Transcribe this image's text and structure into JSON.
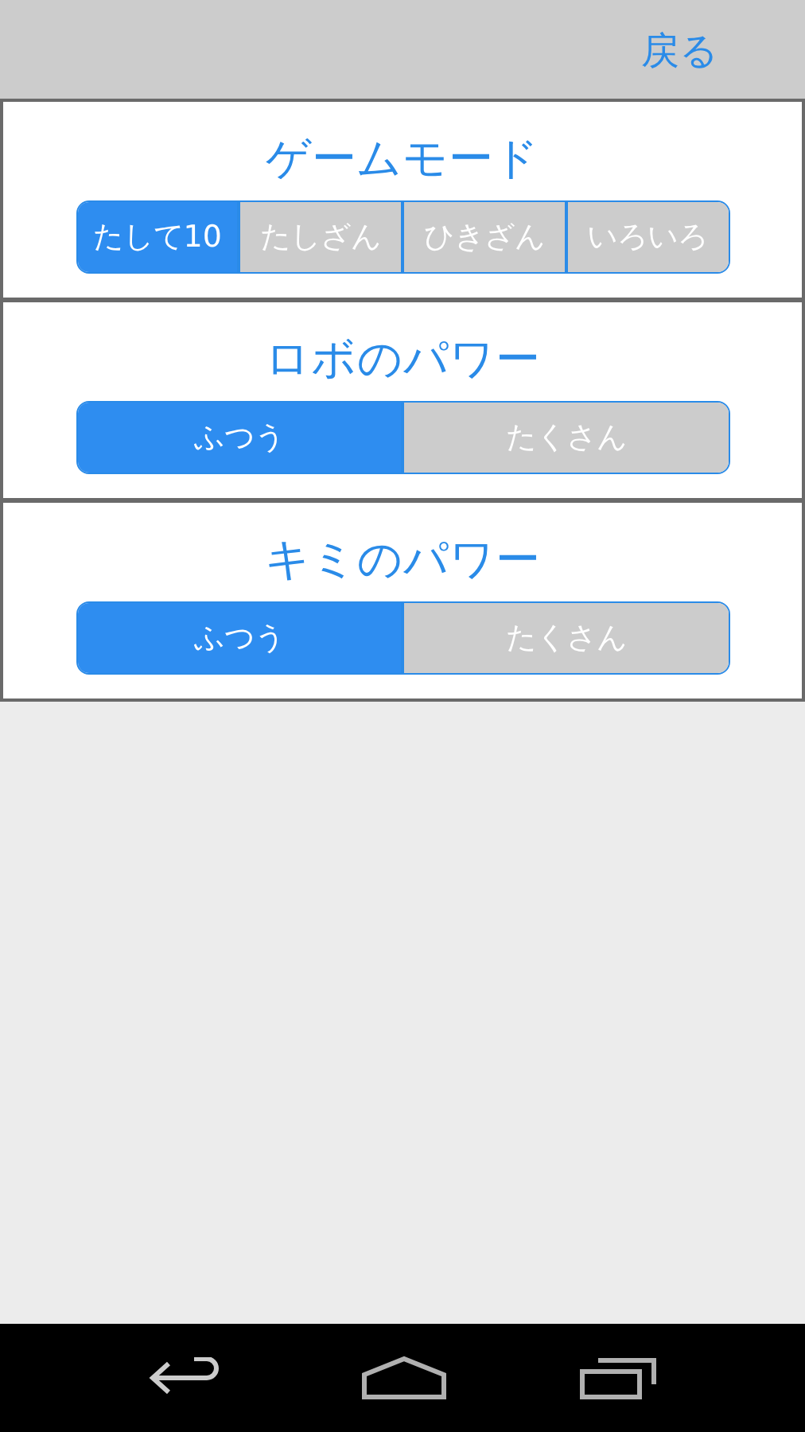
{
  "header": {
    "back_button": "戻る"
  },
  "sections": [
    {
      "title": "ゲームモード",
      "options": [
        {
          "label": "たして10",
          "selected": true
        },
        {
          "label": "たしざん",
          "selected": false
        },
        {
          "label": "ひきざん",
          "selected": false
        },
        {
          "label": "いろいろ",
          "selected": false
        }
      ]
    },
    {
      "title": "ロボのパワー",
      "options": [
        {
          "label": "ふつう",
          "selected": true
        },
        {
          "label": "たくさん",
          "selected": false
        }
      ]
    },
    {
      "title": "キミのパワー",
      "options": [
        {
          "label": "ふつう",
          "selected": true
        },
        {
          "label": "たくさん",
          "selected": false
        }
      ]
    }
  ]
}
